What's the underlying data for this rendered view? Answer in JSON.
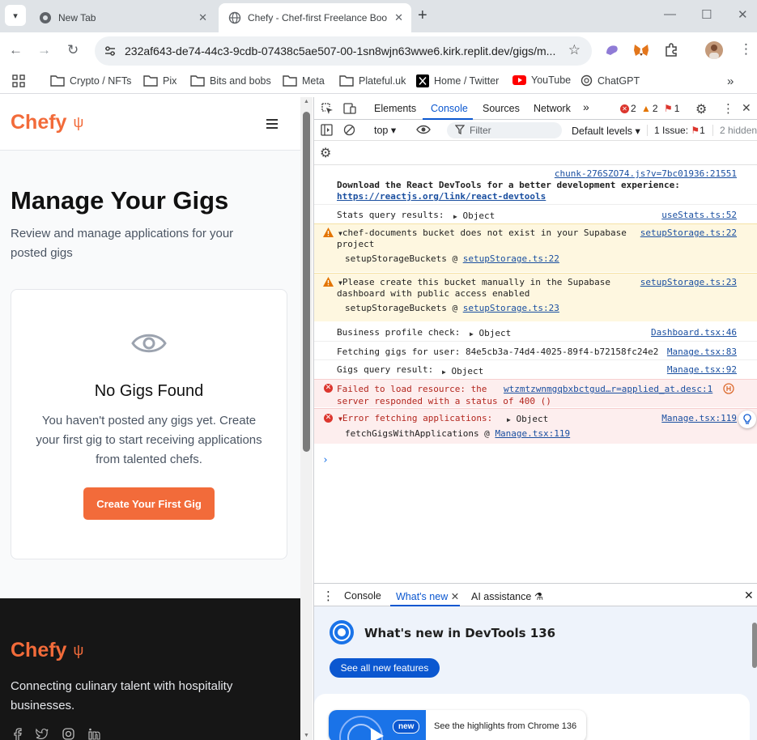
{
  "browser": {
    "tabs": [
      {
        "label": "New Tab",
        "active": false
      },
      {
        "label": "Chefy - Chef-first Freelance Boo",
        "active": true
      }
    ],
    "url": "232af643-de74-44c3-9cdb-07438c5ae507-00-1sn8wjn63wwe6.kirk.replit.dev/gigs/m...",
    "bookmarks": [
      "Crypto / NFTs",
      "Pix",
      "Bits and bobs",
      "Meta",
      "Plateful.uk",
      "Home / Twitter",
      "YouTube",
      "ChatGPT"
    ]
  },
  "site": {
    "logo": "Chefy",
    "logo_icon": "ψ",
    "title": "Manage Your Gigs",
    "subtitle": "Review and manage applications for your posted gigs",
    "empty": {
      "title": "No Gigs Found",
      "text": "You haven't posted any gigs yet. Create your first gig to start receiving applications from talented chefs.",
      "button": "Create Your First Gig"
    },
    "footer": {
      "logo": "Chefy",
      "tagline": "Connecting culinary talent with hospitality businesses."
    }
  },
  "devtools": {
    "tabs": [
      "Elements",
      "Console",
      "Sources",
      "Network"
    ],
    "active_tab": "Console",
    "counts": {
      "errors": "2",
      "warnings": "2",
      "issues": "1"
    },
    "context": "top",
    "filter_placeholder": "Filter",
    "levels": "Default levels",
    "issues_label": "1 Issue:",
    "issues_count": "1",
    "hidden": "2 hidden",
    "messages": {
      "m1_src": "chunk-276SZO74.js?v=7bc01936:21551",
      "m1_line1": "Download the React DevTools for a better development experience:",
      "m1_link": "https://reactjs.org/link/react-devtools",
      "m2_text": "Stats query results:",
      "m2_obj": "Object",
      "m2_src": "useStats.ts:52",
      "m3_line1": "chef-documents bucket does not exist in your Supabase",
      "m3_line2": "project",
      "m3_src": "setupStorage.ts:22",
      "m3_stack": "setupStorageBuckets @",
      "m3_stack_link": "setupStorage.ts:22",
      "m4_line1": "Please create this bucket manually in the Supabase",
      "m4_line2": "dashboard with public access enabled",
      "m4_src": "setupStorage.ts:23",
      "m4_stack": "setupStorageBuckets @",
      "m4_stack_link": "setupStorage.ts:23",
      "m5_text": "Business profile check:",
      "m5_obj": "Object",
      "m5_src": "Dashboard.tsx:46",
      "m6_text": "Fetching gigs for user: 84e5cb3a-74d4-4025-89f4-b72158fc24e2",
      "m6_src": "Manage.tsx:83",
      "m7_text": "Gigs query result:",
      "m7_obj": "Object",
      "m7_src": "Manage.tsx:92",
      "m8_line1": "Failed to load resource: the",
      "m8_src": "wtzmtzwnmgqbxbctgud…r=applied_at.desc:1",
      "m8_line2": "server responded with a status of 400 ()",
      "m9_text": "Error fetching applications:",
      "m9_obj": "Object",
      "m9_src": "Manage.tsx:119",
      "m9_stack": "fetchGigsWithApplications @",
      "m9_stack_link": "Manage.tsx:119"
    },
    "drawer": {
      "tabs": [
        "Console",
        "What's new",
        "AI assistance"
      ],
      "active": "What's new",
      "title": "What's new in DevTools 136",
      "button": "See all new features",
      "new_badge": "new",
      "card_text": "See the highlights from Chrome 136"
    }
  },
  "colors": {
    "brand": "#f26b3a",
    "devtools_accent": "#0b57d0",
    "error": "#dc362e",
    "warning": "#e37400"
  }
}
